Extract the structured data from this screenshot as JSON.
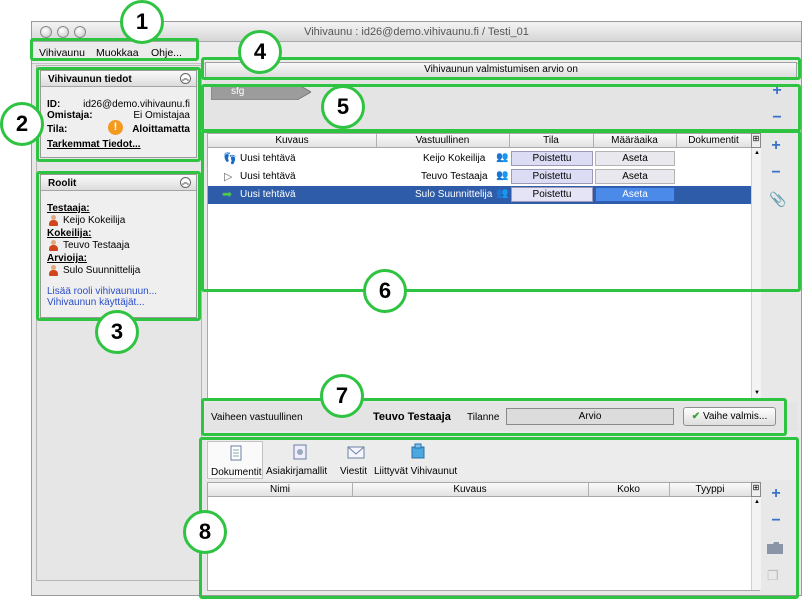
{
  "window": {
    "title": "Vihivaunu : id26@demo.vihivaunu.fi / Testi_01"
  },
  "menu": {
    "items": [
      "Vihivaunu",
      "Muokkaa",
      "Ohje..."
    ]
  },
  "info_panel": {
    "title": "Vihivaunun tiedot",
    "id_label": "ID:",
    "id_value": "id26@demo.vihivaunu.fi",
    "owner_label": "Omistaja:",
    "owner_value": "Ei Omistajaa",
    "state_label": "Tila:",
    "state_value": "Aloittamatta",
    "details_link": "Tarkemmat Tiedot..."
  },
  "roles_panel": {
    "title": "Roolit",
    "roles": [
      {
        "role": "Testaaja:",
        "person": "Keijo Kokeilija"
      },
      {
        "role": "Kokeilija:",
        "person": "Teuvo Testaaja"
      },
      {
        "role": "Arvioija:",
        "person": "Sulo Suunnittelija"
      }
    ],
    "add_role_link": "Lisää rooli vihivaunuun...",
    "users_link": "Vihivaunun käyttäjät..."
  },
  "estimate_bar": {
    "text": "Vihivaunun valmistumisen arvio on"
  },
  "phase": {
    "label": "sfg"
  },
  "tasks_table": {
    "columns": [
      "Kuvaus",
      "Vastuullinen",
      "Tila",
      "Määräaika",
      "Dokumentit"
    ],
    "rows": [
      {
        "kuvaus": "Uusi tehtävä",
        "vastuullinen": "Keijo Kokeilija",
        "tila": "Poistettu",
        "maaraaika": "Aseta",
        "icon": "footsteps-icon",
        "selected": false
      },
      {
        "kuvaus": "Uusi tehtävä",
        "vastuullinen": "Teuvo Testaaja",
        "tila": "Poistettu",
        "maaraaika": "Aseta",
        "icon": "play-outline-icon",
        "selected": false
      },
      {
        "kuvaus": "Uusi tehtävä",
        "vastuullinen": "Sulo Suunnittelija",
        "tila": "Poistettu",
        "maaraaika": "Aseta",
        "icon": "green-arrow-icon",
        "selected": true
      }
    ]
  },
  "phase_bar": {
    "responsible_label": "Vaiheen vastuullinen",
    "responsible_name": "Teuvo Testaaja",
    "status_label": "Tilanne",
    "status_value": "Arvio",
    "done_button": "Vaihe valmis..."
  },
  "doc_tabs": {
    "tabs": [
      "Dokumentit",
      "Asiakirjamallit",
      "Viestit",
      "Liittyvät Vihivaunut"
    ]
  },
  "doc_table": {
    "columns": [
      "Nimi",
      "Kuvaus",
      "Koko",
      "Tyyppi"
    ]
  },
  "callouts": [
    "1",
    "2",
    "3",
    "4",
    "5",
    "6",
    "7",
    "8"
  ],
  "colors": {
    "annotation": "#2fc342",
    "selection": "#2f5ca8",
    "link": "#2a4ec9"
  }
}
